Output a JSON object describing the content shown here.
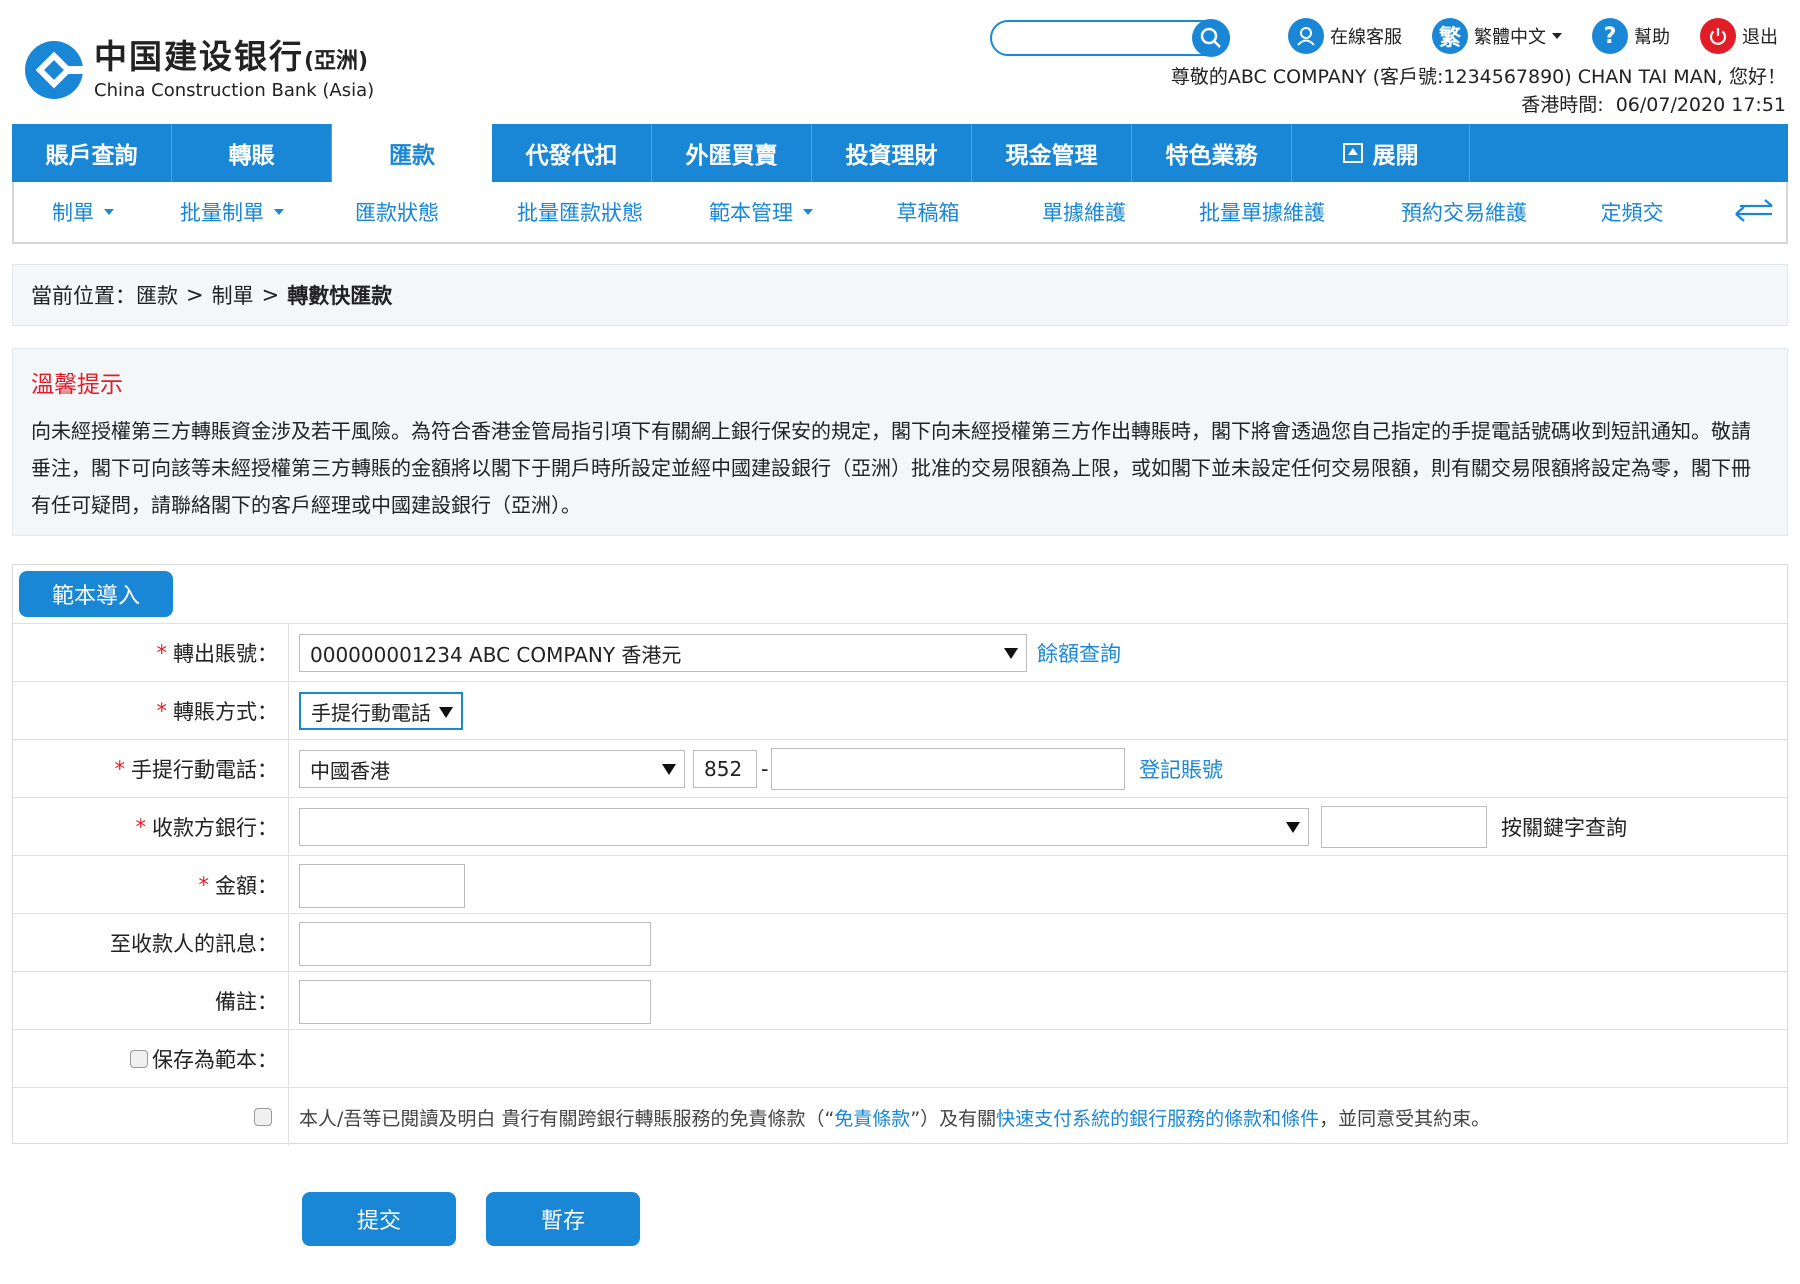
{
  "brand": {
    "name_cn": "中国建设银行",
    "name_cn_suffix": "(亞洲)",
    "name_en": "China Construction Bank (Asia)",
    "primary_color": "#1a87d6",
    "alert_color": "#e11e28"
  },
  "header": {
    "search_placeholder": "",
    "links": {
      "online_service": "在線客服",
      "language_icon": "繁",
      "language": "繁體中文",
      "help": "幫助",
      "logout": "退出"
    },
    "greeting": "尊敬的ABC COMPANY (客戶號:1234567890) CHAN TAI MAN, 您好！",
    "time_label": "香港時間:",
    "time_value": "06/07/2020 17:51"
  },
  "main_nav": [
    {
      "label": "賬戶查詢"
    },
    {
      "label": "轉賬"
    },
    {
      "label": "匯款",
      "active": true
    },
    {
      "label": "代發代扣"
    },
    {
      "label": "外匯買賣"
    },
    {
      "label": "投資理財"
    },
    {
      "label": "現金管理"
    },
    {
      "label": "特色業務"
    },
    {
      "label": "展開"
    }
  ],
  "sub_nav": [
    {
      "label": "制單"
    },
    {
      "label": "批量制單"
    },
    {
      "label": "匯款狀態"
    },
    {
      "label": "批量匯款狀態"
    },
    {
      "label": "範本管理"
    },
    {
      "label": "草稿箱"
    },
    {
      "label": "單據維護"
    },
    {
      "label": "批量單據維護"
    },
    {
      "label": "預約交易維護"
    },
    {
      "label": "定頻交"
    }
  ],
  "breadcrumb": {
    "label": "當前位置：",
    "items": [
      "匯款",
      "制單",
      "轉數快匯款"
    ],
    "sep": ">"
  },
  "notice": {
    "title": "溫馨提示",
    "body": "向未經授權第三方轉賬資金涉及若干風險。為符合香港金管局指引項下有關網上銀行保安的規定，閣下向未經授權第三方作出轉賬時，閣下將會透過您自己指定的手提電話號碼收到短訊通知。敬請垂注，閣下可向該等未經授權第三方轉賬的金額將以閣下于開戶時所設定並經中國建設銀行（亞洲）批准的交易限額為上限，或如閣下並未設定任何交易限額，則有關交易限額將設定為零，閣下冊有任可疑問，請聯絡閣下的客戶經理或中國建設銀行（亞洲）。"
  },
  "form": {
    "template_import": "範本導入",
    "from_account": {
      "label": "轉出賬號：",
      "value": "000000001234 ABC COMPANY 香港元",
      "link": "餘額查詢"
    },
    "transfer_method": {
      "label": "轉賬方式：",
      "value": "手提行動電話"
    },
    "mobile": {
      "label": "手提行動電話：",
      "region": "中國香港",
      "code": "852",
      "dash": "-",
      "number": "",
      "link": "登記賬號"
    },
    "payee_bank": {
      "label": "收款方銀行：",
      "value": "",
      "keyword": "",
      "search_label": "按關鍵字查詢"
    },
    "amount": {
      "label": "金額：",
      "value": ""
    },
    "message": {
      "label": "至收款人的訊息：",
      "value": ""
    },
    "remark": {
      "label": "備註：",
      "value": ""
    },
    "save_template": {
      "label": "保存為範本："
    },
    "agree": {
      "text1": "本人/吾等已閱讀及明白 貴行有關跨銀行轉賬服務的免責條款（“",
      "link1": "免責條款",
      "text2": "”）及有關",
      "link2": "快速支付系統的銀行服務的條款和條件",
      "text3": "，並同意受其約束。"
    }
  },
  "buttons": {
    "submit": "提交",
    "save_draft": "暫存"
  }
}
